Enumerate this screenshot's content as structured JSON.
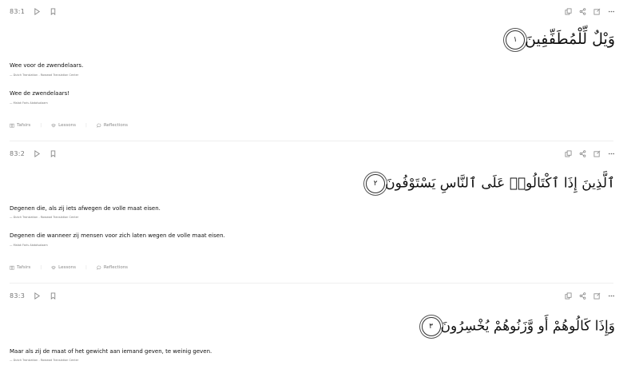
{
  "verses": [
    {
      "key": "83:1",
      "arabic": "وَيْلٌ لِّلْمُطَفِّفِينَ",
      "marker": "١",
      "translations": [
        {
          "text": "Wee voor de zwendelaars.",
          "source": "— Dutch Translation - Rowwad Translation Center"
        },
        {
          "text": "Wee de zwendelaars!",
          "source": "— Malak Faris Abdalsalaam"
        }
      ],
      "links": [
        "Tafsirs",
        "Lessons",
        "Reflections"
      ]
    },
    {
      "key": "83:2",
      "arabic": "ٱلَّذِينَ إِذَا ٱكْتَالُوا۟ عَلَى ٱلنَّاسِ يَسْتَوْفُونَ",
      "marker": "٢",
      "translations": [
        {
          "text": "Degenen die, als zij iets afwegen de volle maat eisen.",
          "source": "— Dutch Translation - Rowwad Translation Center"
        },
        {
          "text": "Degenen die wanneer zij mensen voor zich laten wegen de volle maat eisen.",
          "source": "— Malak Faris Abdalsalaam"
        }
      ],
      "links": [
        "Tafsirs",
        "Lessons",
        "Reflections"
      ]
    },
    {
      "key": "83:3",
      "arabic": "وَإِذَا كَالُوهُمْ أَو وَّزَنُوهُمْ يُخْسِرُونَ",
      "marker": "٣",
      "translations": [
        {
          "text": "Maar als zij de maat of het gewicht aan iemand geven, te weinig geven.",
          "source": "— Dutch Translation - Rowwad Translation Center"
        }
      ]
    }
  ],
  "icons": {
    "play": "play-icon",
    "bookmark": "bookmark-icon",
    "copy": "copy-icon",
    "share": "share-icon",
    "note": "edit-note-icon",
    "more": "more-icon",
    "tafsir": "book-icon",
    "lessons": "lessons-icon",
    "reflections": "chat-icon"
  }
}
